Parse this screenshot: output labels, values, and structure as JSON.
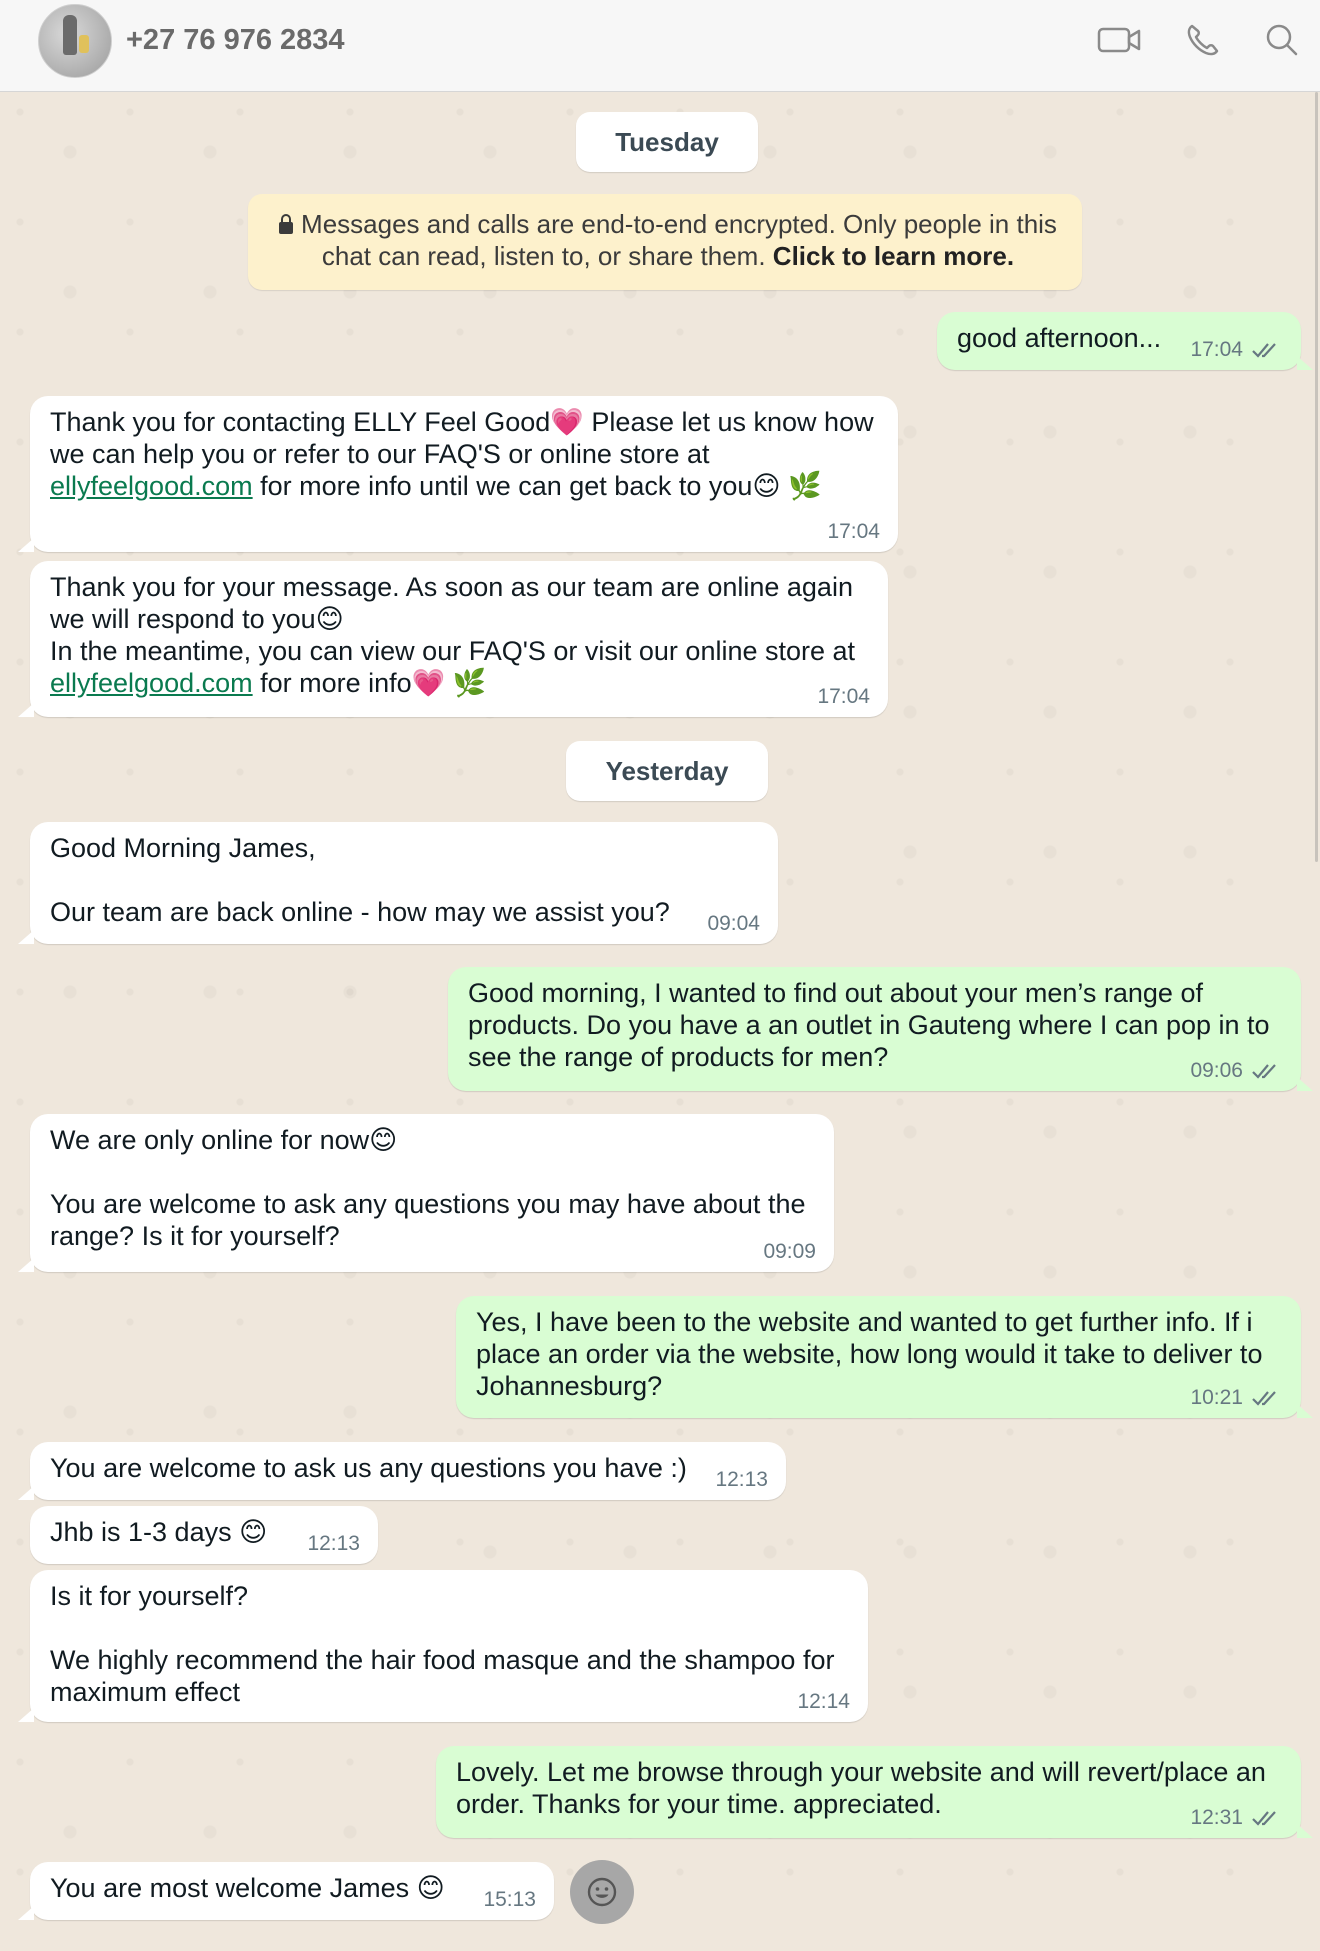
{
  "header": {
    "contact": "+27 76 976 2834"
  },
  "dates": {
    "tuesday": "Tuesday",
    "yesterday": "Yesterday"
  },
  "encryption": {
    "text": "Messages and calls are end-to-end encrypted. Only people in this chat can read, listen to, or share them.",
    "link": "Click to learn more."
  },
  "messages": [
    {
      "dir": "out",
      "text": "good afternoon...",
      "time": "17:04"
    },
    {
      "dir": "in",
      "text_a": "Thank you for contacting ELLY Feel Good💗 Please let us know how we can help you or refer to our FAQ'S or online store at",
      "link": "ellyfeelgood.com",
      "text_b": " for more info until we can get back to you😊 🌿",
      "time": "17:04"
    },
    {
      "dir": "in",
      "text_a": "Thank you for your message. As soon as our team are online again we will respond to you😊\nIn the meantime, you can view our FAQ'S or visit our online store at",
      "link": "ellyfeelgood.com",
      "text_b": " for more info💗 🌿",
      "time": "17:04"
    },
    {
      "dir": "in",
      "text": "Good Morning James,\n\nOur team are back online - how may we assist you?",
      "time": "09:04"
    },
    {
      "dir": "out",
      "text": "Good morning, I wanted to find out about your men’s range of products. Do you have a an outlet in Gauteng where I can pop in to see the range of products for men?",
      "time": "09:06"
    },
    {
      "dir": "in",
      "text": "We are only online for now😊\n\nYou are welcome to ask any questions you may have about the range? Is it for yourself?",
      "time": "09:09"
    },
    {
      "dir": "out",
      "text": "Yes, I have been to the website and wanted to get further info. If i place an order via the website, how long would it take to deliver to Johannesburg?",
      "time": "10:21"
    },
    {
      "dir": "in",
      "text": "You are welcome to ask us any questions you have :)",
      "time": "12:13"
    },
    {
      "dir": "in",
      "text": "Jhb is 1-3 days 😊",
      "time": "12:13"
    },
    {
      "dir": "in",
      "text": "Is it for yourself?\n\nWe highly recommend the hair food masque and the shampoo for maximum effect",
      "time": "12:14"
    },
    {
      "dir": "out",
      "text": "Lovely. Let me browse through your website and will revert/place an order. Thanks for your time. appreciated.",
      "time": "12:31"
    },
    {
      "dir": "in",
      "text": "You are most welcome James 😊",
      "time": "15:13"
    }
  ]
}
